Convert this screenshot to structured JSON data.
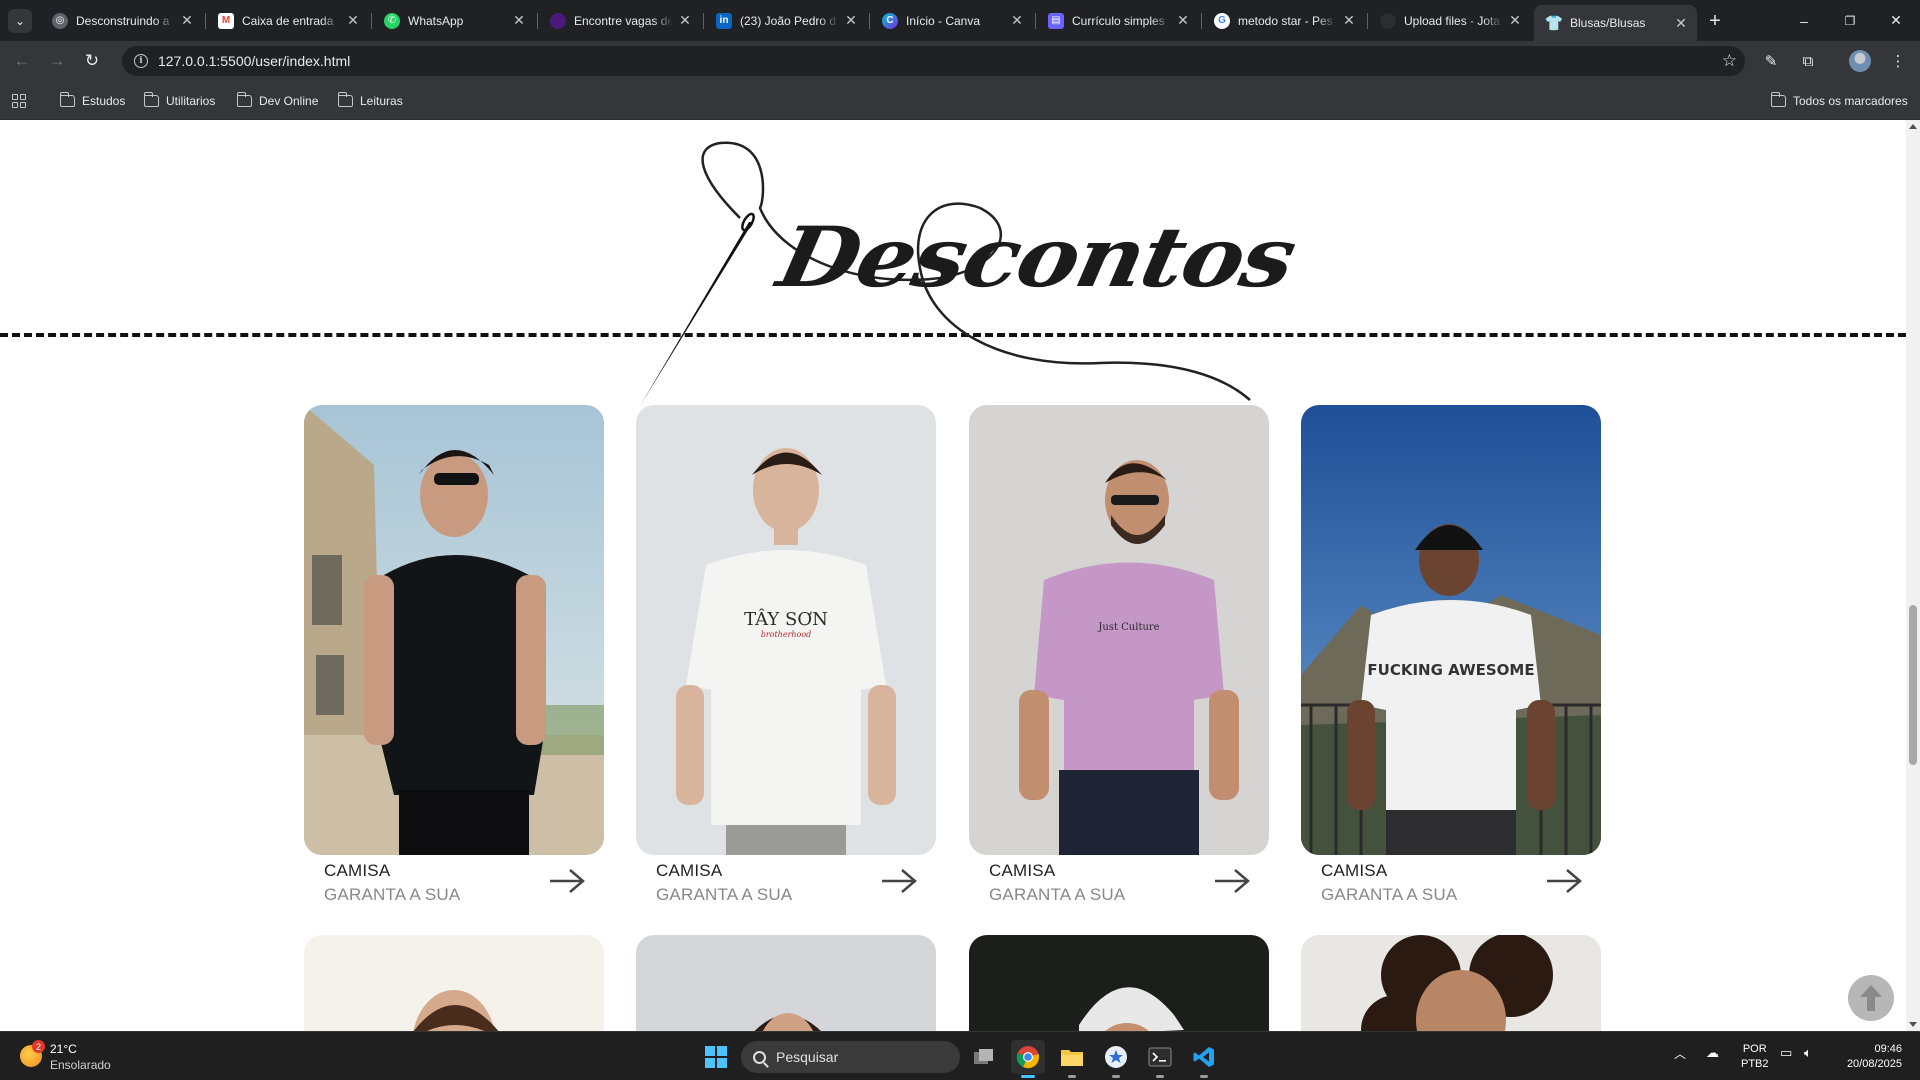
{
  "browser": {
    "tabs": [
      {
        "title": "Desconstruindo a",
        "favicon": "globe-icon",
        "color": "#9aa0a6"
      },
      {
        "title": "Caixa de entrada",
        "favicon": "gmail-icon",
        "color": "#ea4335"
      },
      {
        "title": "WhatsApp",
        "favicon": "whatsapp-icon",
        "color": "#25d366"
      },
      {
        "title": "Encontre vagas de",
        "favicon": "indeed-icon",
        "color": "#6d2ea8"
      },
      {
        "title": "(23) João Pedro d",
        "favicon": "linkedin-icon",
        "color": "#0a66c2"
      },
      {
        "title": "Início - Canva",
        "favicon": "canva-icon",
        "color": "#00c4cc"
      },
      {
        "title": "Currículo simples",
        "favicon": "docs-icon",
        "color": "#7b68ee"
      },
      {
        "title": "metodo star - Pes",
        "favicon": "google-icon",
        "color": "#4285f4"
      },
      {
        "title": "Upload files · Jota",
        "favicon": "github-icon",
        "color": "#24292f"
      },
      {
        "title": "Blusas/Blusas",
        "favicon": "shirt-icon",
        "color": "#a142f4"
      }
    ],
    "active_tab": 9,
    "new_tab": "+",
    "window_controls": {
      "minimize": "–",
      "restore": "❐",
      "close": "✕"
    },
    "url": "127.0.0.1:5500/user/index.html",
    "bookmarks": [
      "Estudos",
      "Utilitarios",
      "Dev Online",
      "Leituras"
    ],
    "all_bookmarks": "Todos os marcadores"
  },
  "page": {
    "heading": "Descontos",
    "products": [
      {
        "title": "CAMISA",
        "subtitle": "GARANTA A SUA",
        "image": "man-black-tshirt",
        "shirt_color": "#121517",
        "bg": "#b7cbd6"
      },
      {
        "title": "CAMISA",
        "subtitle": "GARANTA A SUA",
        "image": "man-white-tshirt",
        "shirt_color": "#f4f4f2",
        "bg": "#dfe2e4"
      },
      {
        "title": "CAMISA",
        "subtitle": "GARANTA A SUA",
        "image": "man-pink-tshirt",
        "shirt_color": "#c597c7",
        "bg": "#d6d4d3"
      },
      {
        "title": "CAMISA",
        "subtitle": "GARANTA A SUA",
        "image": "man-white-graphic-tshirt",
        "shirt_color": "#f1f1f1",
        "bg": "#2f63a6"
      }
    ],
    "products_row2": [
      {
        "image": "woman-portrait-light",
        "bg": "#f4f2ea"
      },
      {
        "image": "woman-portrait-grey",
        "bg": "#d4d6d9"
      },
      {
        "image": "man-white-cap-dark",
        "bg": "#1c1e1c"
      },
      {
        "image": "woman-curly-hair",
        "bg": "#e9e7e4"
      }
    ],
    "print_labels": [
      "TÂY SƠN",
      "brotherhood",
      "Just Culture",
      "FUCKING AWESOME"
    ]
  },
  "taskbar": {
    "weather_badge": "2",
    "temperature": "21°C",
    "weather": "Ensolarado",
    "search_placeholder": "Pesquisar",
    "language": "POR",
    "keyboard": "PTB2",
    "time": "09:46",
    "date": "20/08/2025"
  }
}
